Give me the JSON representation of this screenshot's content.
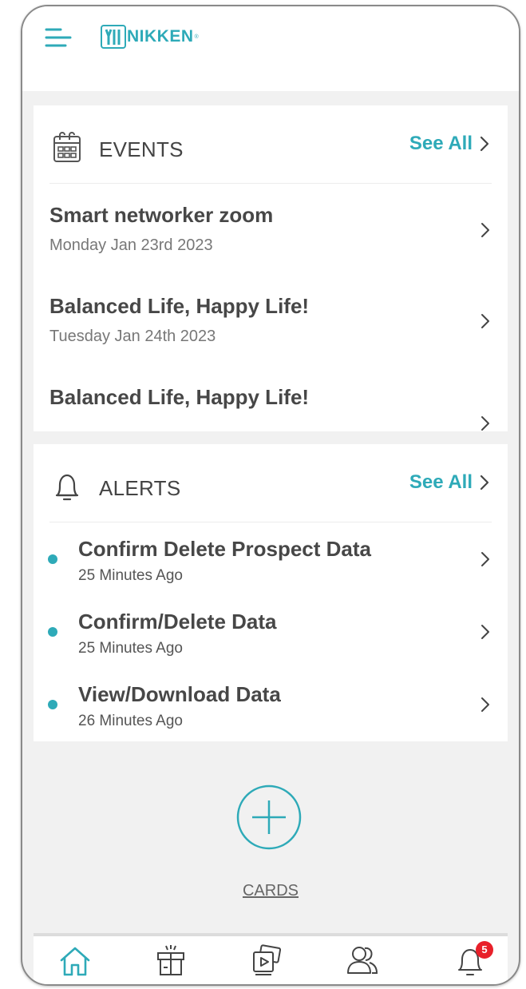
{
  "header": {
    "logo_text": "NIKKEN",
    "logo_reg": "®"
  },
  "events": {
    "title": "EVENTS",
    "see_all": "See All",
    "items": [
      {
        "title": "Smart networker zoom",
        "date": "Monday Jan 23rd 2023"
      },
      {
        "title": "Balanced Life, Happy Life!",
        "date": "Tuesday Jan 24th 2023"
      },
      {
        "title": "Balanced Life, Happy Life!",
        "date": ""
      }
    ]
  },
  "alerts": {
    "title": "ALERTS",
    "see_all": "See All",
    "items": [
      {
        "title": "Confirm Delete Prospect Data",
        "time": "25 Minutes Ago"
      },
      {
        "title": "Confirm/Delete Data",
        "time": "25 Minutes Ago"
      },
      {
        "title": "View/Download Data",
        "time": "26 Minutes Ago"
      }
    ]
  },
  "cards": {
    "label": "CARDS"
  },
  "bottom_nav": {
    "items": [
      {
        "icon": "home-icon",
        "active": true
      },
      {
        "icon": "gift-icon",
        "active": false
      },
      {
        "icon": "media-icon",
        "active": false
      },
      {
        "icon": "people-icon",
        "active": false
      },
      {
        "icon": "bell-icon",
        "active": false
      }
    ],
    "notification_count": "5"
  },
  "colors": {
    "accent": "#2eaab8",
    "badge": "#e8202a",
    "text": "#474747",
    "background": "#f1f1f1"
  }
}
